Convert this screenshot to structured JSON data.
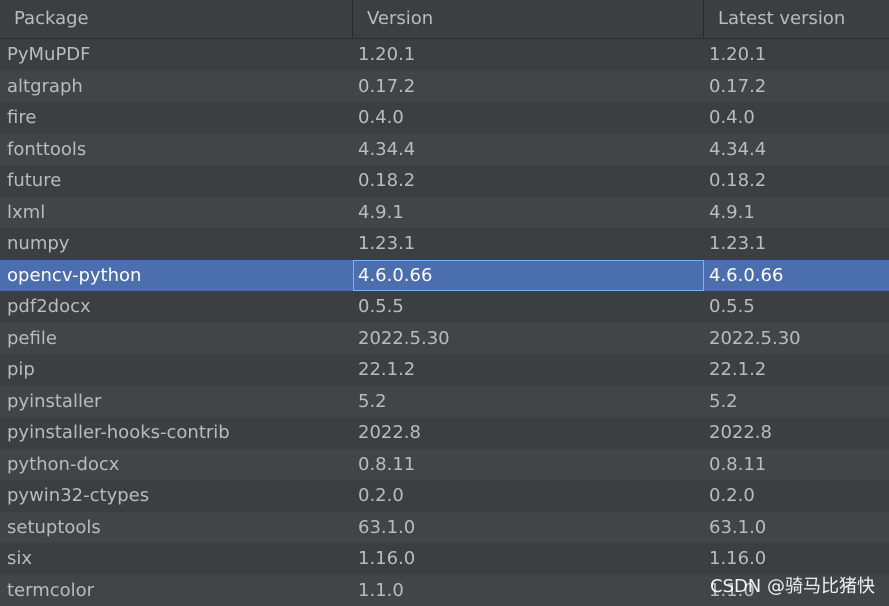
{
  "table": {
    "columns": [
      "Package",
      "Version",
      "Latest version"
    ],
    "selected_index": 7,
    "rows": [
      [
        "PyMuPDF",
        "1.20.1",
        "1.20.1"
      ],
      [
        "altgraph",
        "0.17.2",
        "0.17.2"
      ],
      [
        "fire",
        "0.4.0",
        "0.4.0"
      ],
      [
        "fonttools",
        "4.34.4",
        "4.34.4"
      ],
      [
        "future",
        "0.18.2",
        "0.18.2"
      ],
      [
        "lxml",
        "4.9.1",
        "4.9.1"
      ],
      [
        "numpy",
        "1.23.1",
        "1.23.1"
      ],
      [
        "opencv-python",
        "4.6.0.66",
        "4.6.0.66"
      ],
      [
        "pdf2docx",
        "0.5.5",
        "0.5.5"
      ],
      [
        "pefile",
        "2022.5.30",
        "2022.5.30"
      ],
      [
        "pip",
        "22.1.2",
        "22.1.2"
      ],
      [
        "pyinstaller",
        "5.2",
        "5.2"
      ],
      [
        "pyinstaller-hooks-contrib",
        "2022.8",
        "2022.8"
      ],
      [
        "python-docx",
        "0.8.11",
        "0.8.11"
      ],
      [
        "pywin32-ctypes",
        "0.2.0",
        "0.2.0"
      ],
      [
        "setuptools",
        "63.1.0",
        "63.1.0"
      ],
      [
        "six",
        "1.16.0",
        "1.16.0"
      ],
      [
        "termcolor",
        "1.1.0",
        "1.1.0"
      ]
    ]
  },
  "watermark": "CSDN @骑马比猪快",
  "colors": {
    "background": "#3c3f41",
    "row_alt": "#414547",
    "selected": "#4b6eaf",
    "text": "#bbbbbb"
  }
}
